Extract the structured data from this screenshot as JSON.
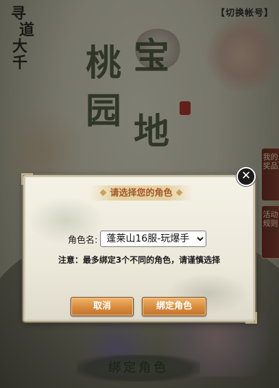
{
  "logo": {
    "line1": "寻",
    "line2": "道",
    "line3": "大千"
  },
  "header": {
    "switch_account": "【切换帐号】"
  },
  "title_art": {
    "c1": "桃",
    "c2": "宝",
    "c3": "园",
    "c4": "地"
  },
  "side_tabs": [
    {
      "label": "我的奖品"
    },
    {
      "label": "活动规则"
    }
  ],
  "dialog": {
    "title": "请选择您的角色",
    "role_label": "角色名:",
    "role_options": [
      "蓬莱山16服-玩爆手"
    ],
    "notice": "注意：最多绑定3个不同的角色，请谨慎选择",
    "cancel_label": "取消",
    "bind_label": "绑定角色",
    "close_symbol": "✕"
  },
  "footer": {
    "bind_button": "绑定角色"
  },
  "colors": {
    "button_orange": "#d98a3d",
    "title_brown": "#a4572a",
    "side_tab_red": "#6b2a1e"
  }
}
